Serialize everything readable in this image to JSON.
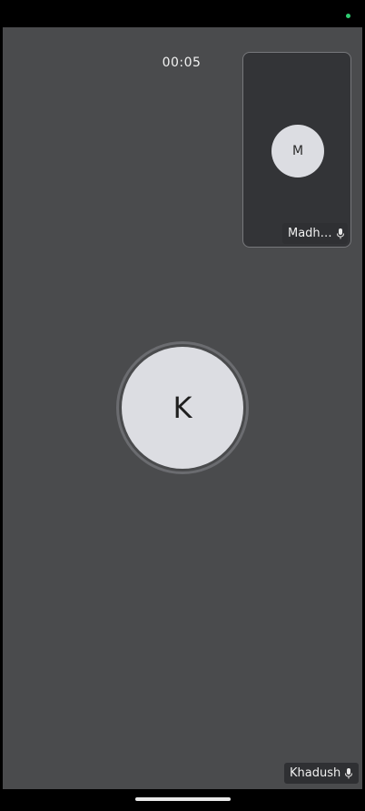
{
  "call": {
    "timer": "00:05",
    "remote": {
      "initial": "M",
      "name": "Madh…"
    },
    "local": {
      "initial": "K",
      "name": "Khadush"
    }
  },
  "icons": {
    "mic": "mic-icon",
    "status": "status-dot"
  },
  "colors": {
    "background": "#4a4b4d",
    "pip_background": "#333437",
    "avatar": "#dcdde2",
    "status_dot": "#2ecc71"
  }
}
